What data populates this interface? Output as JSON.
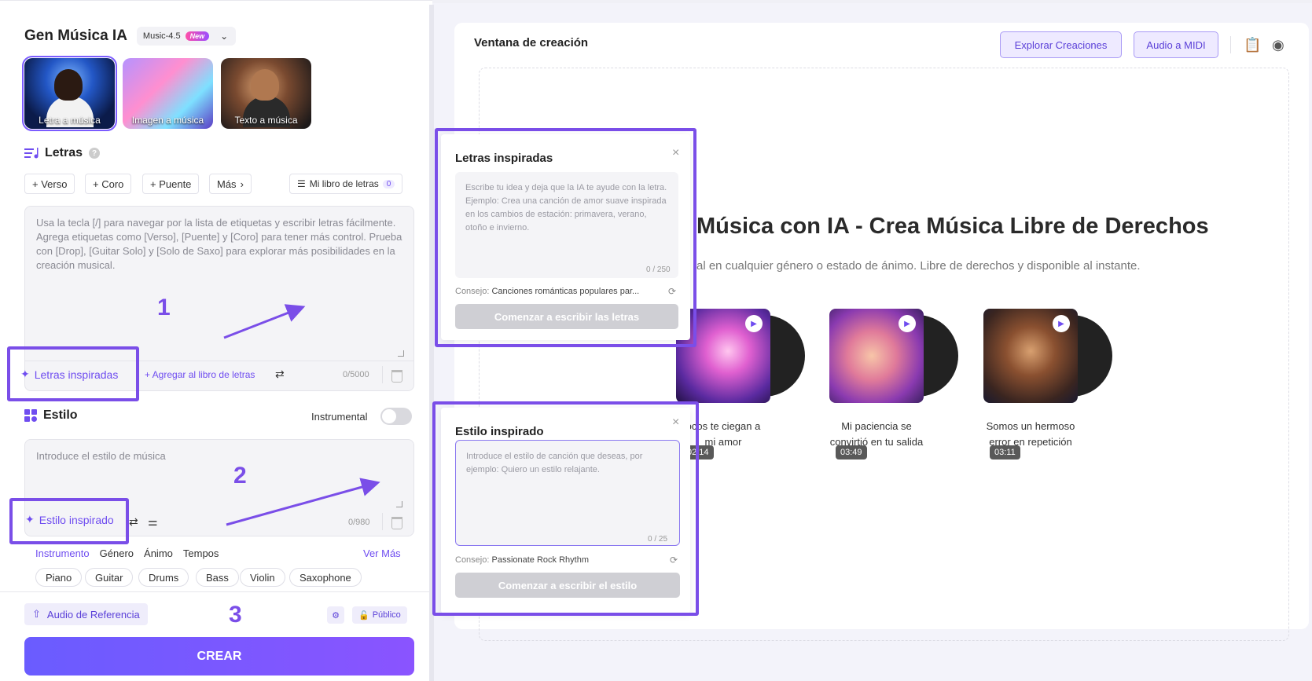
{
  "app": {
    "title": "Gen Música IA",
    "model": "Music-4.5",
    "model_badge": "New"
  },
  "modes": [
    {
      "label": "Letra a música"
    },
    {
      "label": "Imagen a música"
    },
    {
      "label": "Texto a música"
    }
  ],
  "lyrics": {
    "heading": "Letras",
    "chips": [
      "+ Verso",
      "+ Coro",
      "+ Puente",
      "Más"
    ],
    "book_label": "Mi libro de letras",
    "book_count": "0",
    "placeholder": "Usa la tecla [/] para navegar por la lista de etiquetas y escribir letras fácilmente. Agrega etiquetas como [Verso], [Puente] y [Coro] para tener más control. Prueba con [Drop], [Guitar Solo] y [Solo de Saxo] para explorar más posibilidades en la creación musical.",
    "inspired_label": "Letras inspiradas",
    "add_book_label": "+ Agregar al libro de letras",
    "counter": "0/5000"
  },
  "style": {
    "heading": "Estilo",
    "instrumental_label": "Instrumental",
    "placeholder": "Introduce el estilo de música",
    "inspired_label": "Estilo inspirado",
    "counter": "0/980",
    "tabs": [
      "Instrumento",
      "Género",
      "Ánimo",
      "Tempos"
    ],
    "see_more": "Ver Más",
    "pills": [
      "Piano",
      "Guitar",
      "Drums",
      "Bass",
      "Violin",
      "Saxophone"
    ]
  },
  "annotations": [
    "1",
    "2",
    "3"
  ],
  "bottom": {
    "reference_audio": "Audio de Referencia",
    "public_label": "Público",
    "create_label": "CREAR"
  },
  "panel": {
    "title": "Ventana de creación",
    "explore_btn": "Explorar Creaciones",
    "midi_btn": "Audio a MIDI",
    "big_title": "Música con IA - Crea Música Libre de Derechos",
    "subtitle": "al en cualquier género o estado de ánimo. Libre de derechos y disponible al instante."
  },
  "songs": [
    {
      "duration": "02:14",
      "title": "ocos te ciegan a\nmi amor"
    },
    {
      "duration": "03:49",
      "title": "Mi paciencia se\nconvirtió en tu salida"
    },
    {
      "duration": "03:11",
      "title": "Somos un hermoso\nerror en repetición"
    }
  ],
  "popup_lyrics": {
    "title": "Letras inspiradas",
    "placeholder": "Escribe tu idea y deja que la IA te ayude con la letra. Ejemplo: Crea una canción de amor suave inspirada en los cambios de estación: primavera, verano, otoño e invierno.",
    "counter": "0 / 250",
    "tip_label": "Consejo:",
    "tip_value": "Canciones románticas populares par...",
    "button": "Comenzar a escribir las letras"
  },
  "popup_style": {
    "title": "Estilo inspirado",
    "placeholder": "Introduce el estilo de canción que deseas, por ejemplo: Quiero un estilo relajante.",
    "counter": "0 / 25",
    "tip_label": "Consejo:",
    "tip_value": "Passionate Rock Rhythm",
    "button": "Comenzar a escribir el estilo"
  },
  "colors": {
    "accent": "#6f4df0",
    "highlight": "#7a4ee8",
    "create_gradient_start": "#6a5cff",
    "create_gradient_end": "#8a54ff"
  }
}
